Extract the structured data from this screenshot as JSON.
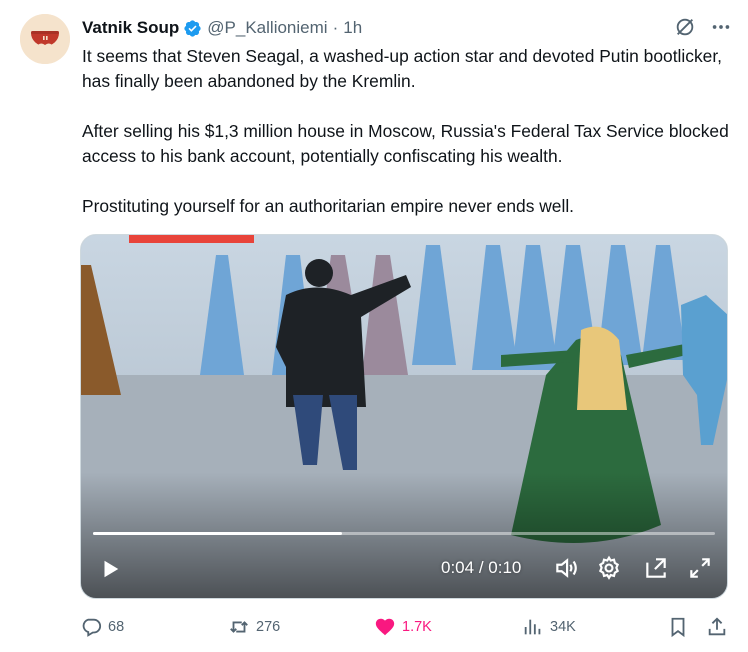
{
  "author": {
    "display_name": "Vatnik Soup",
    "handle": "@P_Kallioniemi",
    "separator": "·",
    "time": "1h",
    "verified_color": "#1d9bf0"
  },
  "tweet": {
    "paragraphs": [
      "It seems that Steven Seagal, a washed-up action star and devoted Putin bootlicker, has finally been abandoned by the Kremlin.",
      "After selling his $1,3 million house in Moscow, Russia's Federal Tax Service blocked access to his bank account, potentially confiscating his wealth.",
      "Prostituting yourself for an authoritarian empire never ends well."
    ]
  },
  "video": {
    "current_time": "0:04",
    "duration": "0:10",
    "time_separator": "/",
    "progress_fraction": 0.4
  },
  "actions": {
    "replies": "68",
    "reposts": "276",
    "likes": "1.7K",
    "views": "34K",
    "like_color": "#f91880",
    "icon_color": "#536471"
  },
  "icons": {
    "avatar": "bowl-with-mustache-avatar",
    "verified": "verified-badge-icon",
    "grok": "grok-icon",
    "more": "more-options-icon",
    "play": "play-icon",
    "volume": "volume-icon",
    "settings": "gear-icon",
    "pip": "picture-in-picture-icon",
    "fullscreen": "fullscreen-icon",
    "reply": "reply-icon",
    "repost": "repost-icon",
    "like": "heart-icon",
    "views": "views-icon",
    "bookmark": "bookmark-icon",
    "share": "share-icon"
  }
}
